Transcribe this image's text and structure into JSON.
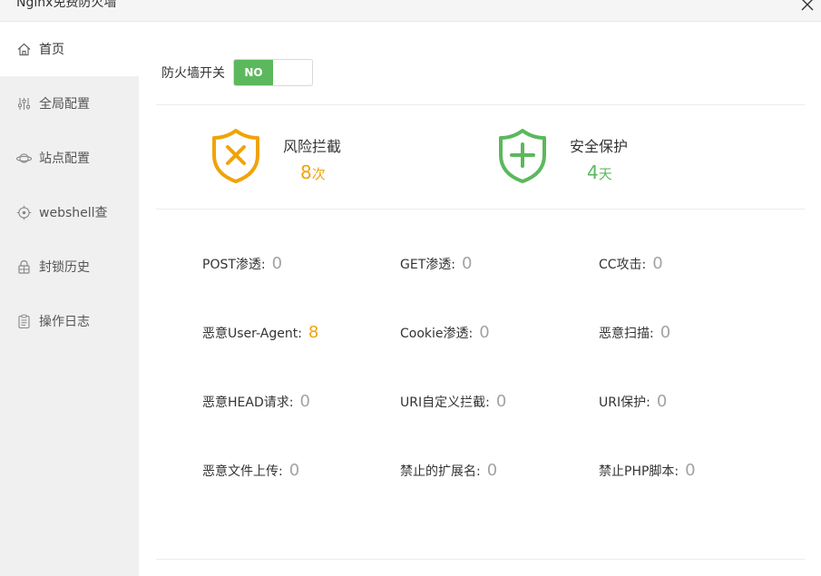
{
  "window": {
    "title": "Nginx免费防火墙"
  },
  "sidebar": {
    "items": [
      {
        "label": "首页",
        "icon": "home-icon"
      },
      {
        "label": "全局配置",
        "icon": "sliders-icon"
      },
      {
        "label": "站点配置",
        "icon": "planet-icon"
      },
      {
        "label": "webshell查",
        "icon": "crosshair-icon"
      },
      {
        "label": "封锁历史",
        "icon": "lock-history-icon"
      },
      {
        "label": "操作日志",
        "icon": "clipboard-icon"
      }
    ],
    "active": "首页"
  },
  "firewall": {
    "switch_label": "防火墙开关",
    "toggle_text": "NO"
  },
  "stats": {
    "risk": {
      "title": "风险拦截",
      "value": "8",
      "unit": "次",
      "color": "#f0a30a",
      "icon": "shield-x-icon"
    },
    "protect": {
      "title": "安全保护",
      "value": "4",
      "unit": "天",
      "color": "#5cb85c",
      "icon": "shield-plus-icon"
    }
  },
  "metrics": [
    {
      "label": "POST渗透:",
      "value": "0"
    },
    {
      "label": "GET渗透:",
      "value": "0"
    },
    {
      "label": "CC攻击:",
      "value": "0"
    },
    {
      "label": "恶意User-Agent:",
      "value": "8"
    },
    {
      "label": "Cookie渗透:",
      "value": "0"
    },
    {
      "label": "恶意扫描:",
      "value": "0"
    },
    {
      "label": "恶意HEAD请求:",
      "value": "0"
    },
    {
      "label": "URI自定义拦截:",
      "value": "0"
    },
    {
      "label": "URI保护:",
      "value": "0"
    },
    {
      "label": "恶意文件上传:",
      "value": "0"
    },
    {
      "label": "禁止的扩展名:",
      "value": "0"
    },
    {
      "label": "禁止PHP脚本:",
      "value": "0"
    }
  ]
}
